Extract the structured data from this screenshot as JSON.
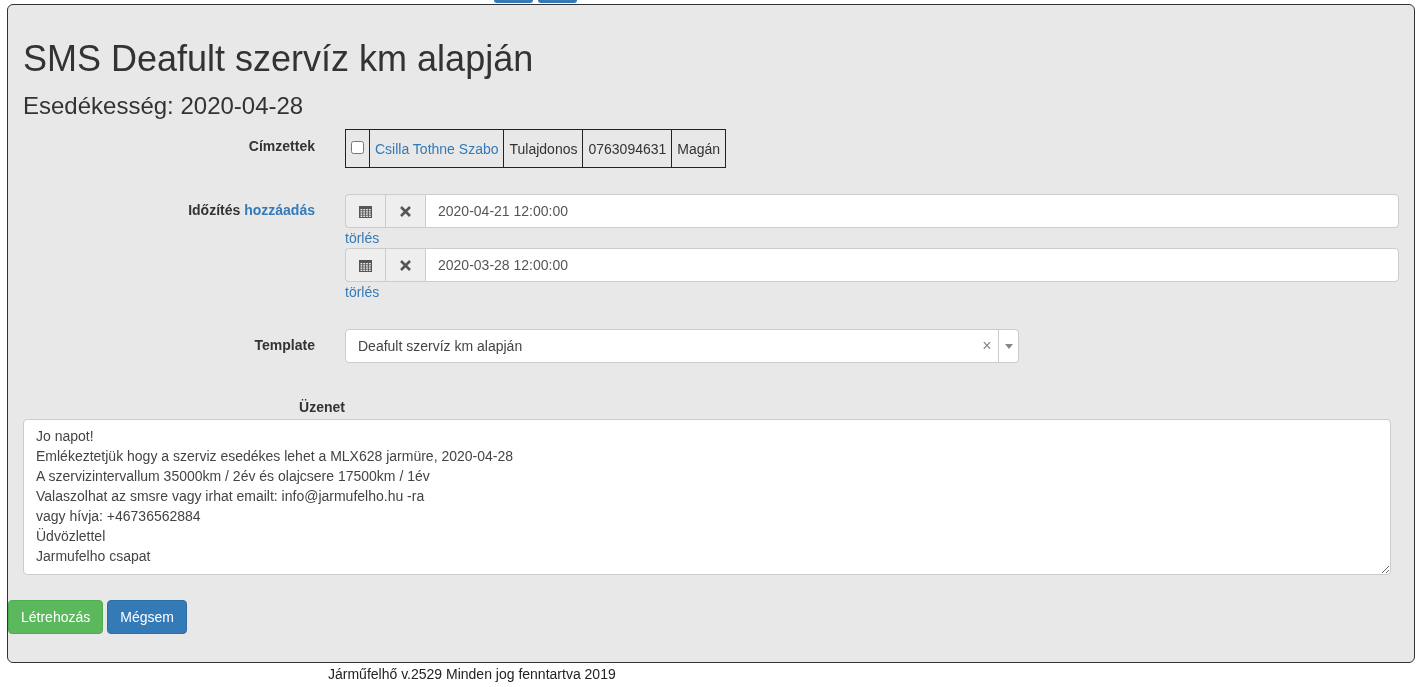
{
  "top_buttons": [
    {
      "kind": "edge"
    },
    {
      "kind": "edge"
    }
  ],
  "title": "SMS Deafult szervíz km alapján",
  "subtitle": "Esedékesség: 2020-04-28",
  "recipients": {
    "label": "Címzettek",
    "rows": [
      {
        "checked": false,
        "name": "Csilla Tothne Szabo",
        "role": "Tulajdonos",
        "phone": "0763094631",
        "type": "Magán"
      }
    ]
  },
  "schedule": {
    "label": "Időzítés",
    "add_link": "hozzáadás",
    "entries": [
      {
        "value": "2020-04-21 12:00:00",
        "delete_link": "törlés"
      },
      {
        "value": "2020-03-28 12:00:00",
        "delete_link": "törlés"
      }
    ]
  },
  "template": {
    "label": "Template",
    "value": "Deafult szervíz km alapján",
    "clear": "×"
  },
  "message": {
    "label": "Üzenet",
    "lines": [
      "Jo napot!",
      "Emlékeztetjük hogy a szerviz esedékes lehet a MLX628 jarmüre, 2020-04-28",
      "A szervizintervallum 35000km / 2év és olajcsere 17500km / 1év",
      "Valaszolhat az smsre vagy irhat emailt: info@jarmufelho.hu -ra",
      "vagy hívja: +46736562884",
      "Üdvözlettel",
      "Jarmufelho csapat"
    ]
  },
  "buttons": [
    {
      "label": "Létrehozás",
      "kind": "success"
    },
    {
      "label": "Mégsem",
      "kind": "primary"
    }
  ],
  "footer": "Járműfelhő v.2529 Minden jog fenntartva 2019"
}
